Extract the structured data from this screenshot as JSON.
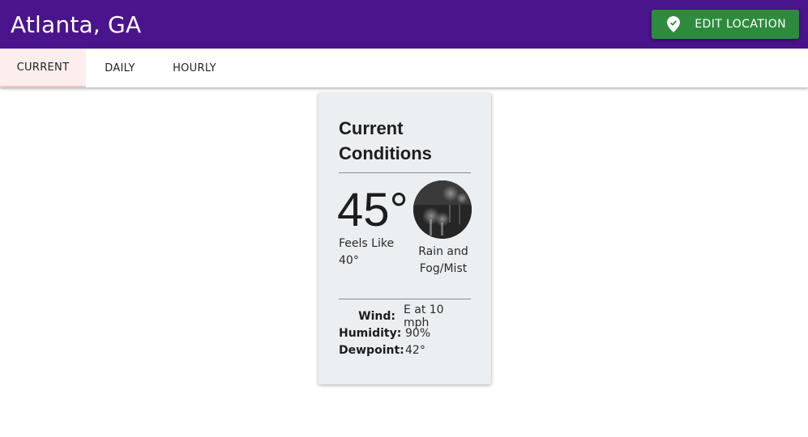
{
  "header": {
    "city": "Atlanta, GA",
    "edit_button_label": "EDIT LOCATION",
    "edit_button_icon": "map-pin-icon",
    "background_color": "#4a148c",
    "button_color": "#2e8b3e"
  },
  "tabs": [
    {
      "label": "CURRENT",
      "active": true
    },
    {
      "label": "DAILY",
      "active": false
    },
    {
      "label": "HOURLY",
      "active": false
    }
  ],
  "current": {
    "title": "Current Conditions",
    "temperature": "45°",
    "feels_like_label": "Feels Like",
    "feels_like_value": "40°",
    "condition": "Rain and Fog/Mist",
    "condition_icon": "rain-fog-icon",
    "details": [
      {
        "label": "Wind:",
        "value": "E at 10 mph"
      },
      {
        "label": "Humidity:",
        "value": "90%"
      },
      {
        "label": "Dewpoint:",
        "value": "42°"
      }
    ]
  }
}
